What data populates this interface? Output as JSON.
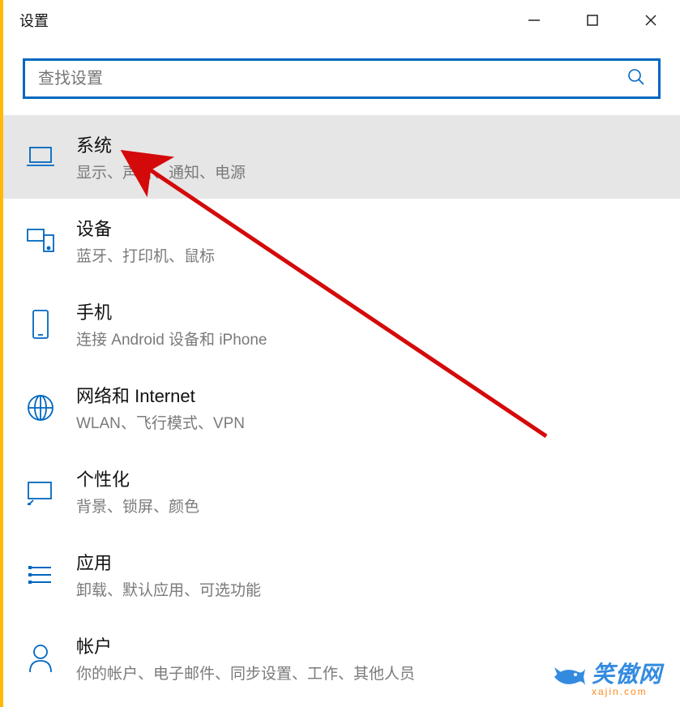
{
  "window": {
    "title": "设置"
  },
  "search": {
    "placeholder": "查找设置"
  },
  "items": [
    {
      "icon": "laptop-icon",
      "title": "系统",
      "desc": "显示、声音、通知、电源",
      "selected": true
    },
    {
      "icon": "devices-icon",
      "title": "设备",
      "desc": "蓝牙、打印机、鼠标",
      "selected": false
    },
    {
      "icon": "phone-icon",
      "title": "手机",
      "desc": "连接 Android 设备和 iPhone",
      "selected": false
    },
    {
      "icon": "globe-icon",
      "title": "网络和 Internet",
      "desc": "WLAN、飞行模式、VPN",
      "selected": false
    },
    {
      "icon": "personalize-icon",
      "title": "个性化",
      "desc": "背景、锁屏、颜色",
      "selected": false
    },
    {
      "icon": "apps-icon",
      "title": "应用",
      "desc": "卸载、默认应用、可选功能",
      "selected": false
    },
    {
      "icon": "account-icon",
      "title": "帐户",
      "desc": "你的帐户、电子邮件、同步设置、工作、其他人员",
      "selected": false
    }
  ],
  "watermark": {
    "text": "笑傲网",
    "sub": "xajin.com"
  }
}
